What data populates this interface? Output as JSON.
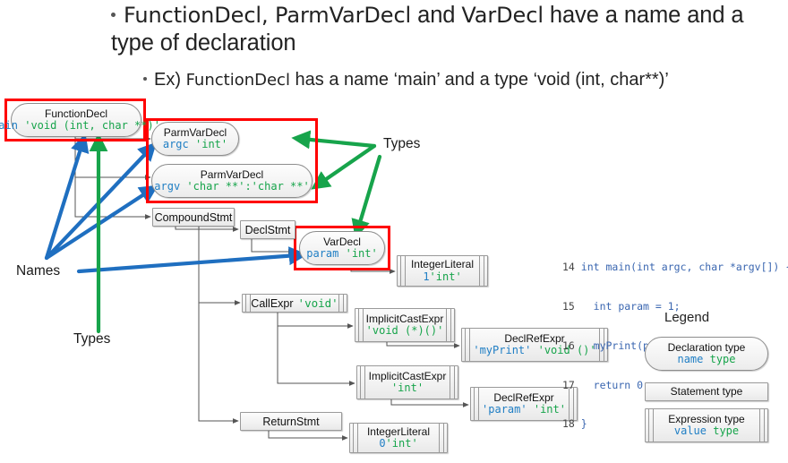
{
  "slide": {
    "heading": {
      "bullet1_pre": "FunctionDecl, ParmVarDecl",
      "bullet1_mid": " and ",
      "bullet1_code2": "VarDecl",
      "bullet1_post": " have a name and a type of declaration",
      "bullet1_full": "FunctionDecl, ParmVarDecl and VarDecl have a name and a type of declaration",
      "bullet2_pre": "Ex) ",
      "bullet2_code": "FunctionDecl",
      "bullet2_post": " has a name ‘main’ and a type ‘void (int, char**)’"
    },
    "colors": {
      "name_blue": "#1f7ec4",
      "type_green": "#17a44b",
      "highlight_red": "#ff0000",
      "arrow_blue": "#1f6fc0",
      "arrow_green": "#17a44b",
      "code_blue": "#3a66b0"
    },
    "nodes": [
      {
        "id": "functiondecl",
        "kind": "decl",
        "line1": "FunctionDecl",
        "name": "main",
        "type": "'void (int, char **)'"
      },
      {
        "id": "parmvardecl1",
        "kind": "decl",
        "line1": "ParmVarDecl",
        "name": "argc",
        "type": "'int'"
      },
      {
        "id": "parmvardecl2",
        "kind": "decl",
        "line1": "ParmVarDecl",
        "name": "argv",
        "type": "'char **':'char **'"
      },
      {
        "id": "compoundstmt",
        "kind": "stmt",
        "line1": "CompoundStmt",
        "name": "",
        "type": ""
      },
      {
        "id": "declstmt",
        "kind": "stmt",
        "line1": "DeclStmt",
        "name": "",
        "type": ""
      },
      {
        "id": "vardecl",
        "kind": "decl",
        "line1": "VarDecl",
        "name": "param",
        "type": "'int'"
      },
      {
        "id": "intliteral1",
        "kind": "expr",
        "line1": "IntegerLiteral",
        "name": "1",
        "type": "'int'"
      },
      {
        "id": "callexpr",
        "kind": "expr",
        "line1": "CallExpr",
        "name": "",
        "type": "'void'"
      },
      {
        "id": "implicitcast1",
        "kind": "expr",
        "line1": "ImplicitCastExpr",
        "name": "",
        "type": "'void (*)()'"
      },
      {
        "id": "declrefexpr1",
        "kind": "expr",
        "line1": "DeclRefExpr",
        "name": "'myPrint'",
        "type": "'void ()'"
      },
      {
        "id": "implicitcast2",
        "kind": "expr",
        "line1": "ImplicitCastExpr",
        "name": "",
        "type": "'int'"
      },
      {
        "id": "declrefexpr2",
        "kind": "expr",
        "line1": "DeclRefExpr",
        "name": "'param'",
        "type": "'int'"
      },
      {
        "id": "returnstmt",
        "kind": "stmt",
        "line1": "ReturnStmt",
        "name": "",
        "type": ""
      },
      {
        "id": "intliteral0",
        "kind": "expr",
        "line1": "IntegerLiteral",
        "name": "0",
        "type": "'int'"
      }
    ],
    "annotations": [
      {
        "id": "names-label",
        "text": "Names",
        "color": "#1f6fc0"
      },
      {
        "id": "types-label-left",
        "text": "Types",
        "color": "#17a44b"
      },
      {
        "id": "types-label-right",
        "text": "Types",
        "color": "#17a44b"
      }
    ],
    "code": {
      "lines": [
        {
          "no": "14",
          "text": "int main(int argc, char *argv[]) {"
        },
        {
          "no": "15",
          "text": "  int param = 1;"
        },
        {
          "no": "16",
          "text": "  myPrint(param);"
        },
        {
          "no": "17",
          "text": "  return 0;"
        },
        {
          "no": "18",
          "text": "}"
        }
      ]
    },
    "legend": {
      "title": "Legend",
      "items": [
        {
          "id": "declaration",
          "kind": "decl",
          "title": "Declaration type",
          "name": "name",
          "type": "type"
        },
        {
          "id": "statement",
          "kind": "stmt",
          "title": "Statement type",
          "name": "",
          "type": ""
        },
        {
          "id": "expression",
          "kind": "expr",
          "title": "Expression type",
          "name": "value",
          "type": "type"
        }
      ]
    }
  }
}
